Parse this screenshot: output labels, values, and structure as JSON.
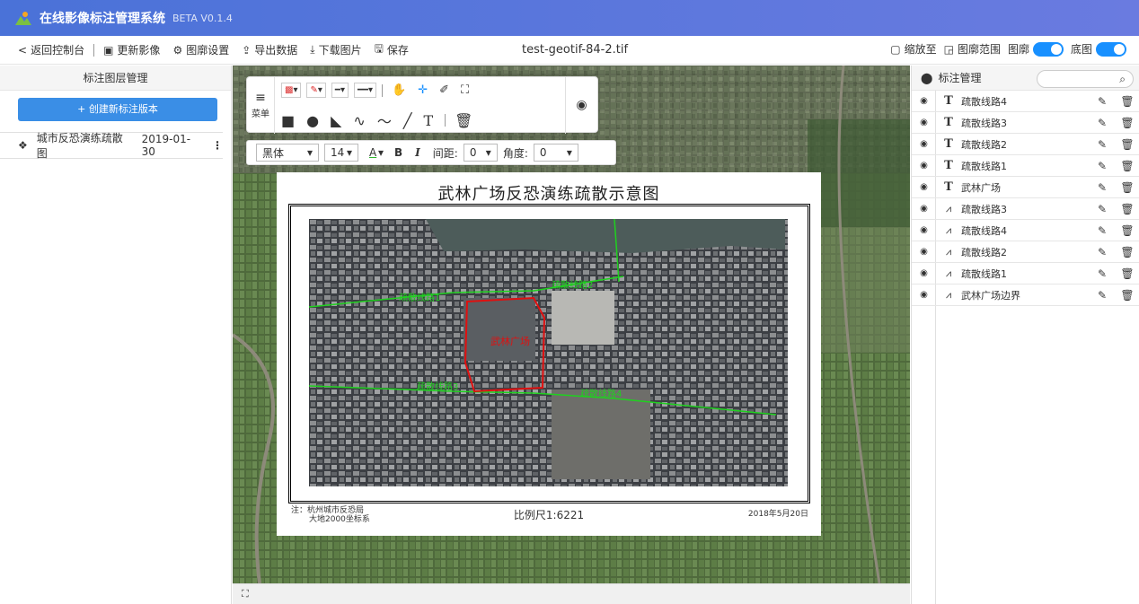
{
  "header": {
    "app_title": "在线影像标注管理系统",
    "version": "BETA V0.1.4"
  },
  "toolbar": {
    "back_label": "返回控制台",
    "update_image_label": "更新影像",
    "map_settings_label": "图廓设置",
    "export_label": "导出数据",
    "download_label": "下载图片",
    "save_label": "保存",
    "filename": "test-geotif-84-2.tif",
    "zoom_to_label": "缩放至",
    "frame_range_label": "图廓范围",
    "frame_toggle_label": "图廓",
    "basemap_toggle_label": "底图",
    "frame_toggle_on": true,
    "basemap_toggle_on": true
  },
  "left_panel": {
    "title": "标注图层管理",
    "create_button": "+ 创建新标注版本",
    "layers": [
      {
        "name": "城市反恐演练疏散图",
        "date": "2019-01-30"
      }
    ]
  },
  "draw_tools": {
    "menu_label": "菜单"
  },
  "font_toolbar": {
    "font_family": "黑体",
    "font_size": "14",
    "spacing_label": "间距:",
    "spacing_value": "0",
    "angle_label": "角度:",
    "angle_value": "0"
  },
  "map_sheet": {
    "title": "武林广场反恐演练疏散示意图",
    "note_line1": "注：杭州城市反恐局",
    "note_line2": "大地2000坐标系",
    "scale": "比例尺1:6221",
    "date": "2018年5月20日",
    "labels": {
      "route1": "疏散线路1",
      "route2": "疏散线路2",
      "route3": "疏散线路3",
      "route4": "疏散线路4",
      "square": "武林广场"
    },
    "colors": {
      "route": "#1fd11f",
      "boundary": "#e01010"
    }
  },
  "right_panel": {
    "title": "标注管理",
    "annotations": [
      {
        "type": "text",
        "name": "疏散线路4"
      },
      {
        "type": "text",
        "name": "疏散线路3"
      },
      {
        "type": "text",
        "name": "疏散线路2"
      },
      {
        "type": "text",
        "name": "疏散线路1"
      },
      {
        "type": "text",
        "name": "武林广场"
      },
      {
        "type": "line",
        "name": "疏散线路3"
      },
      {
        "type": "line",
        "name": "疏散线路4"
      },
      {
        "type": "line",
        "name": "疏散线路2"
      },
      {
        "type": "line",
        "name": "疏散线路1"
      },
      {
        "type": "line",
        "name": "武林广场边界"
      }
    ]
  },
  "colors": {
    "header_start": "#4a72d8",
    "header_end": "#6a7be0",
    "primary_button": "#3a8ee6",
    "toggle": "#1890ff"
  }
}
